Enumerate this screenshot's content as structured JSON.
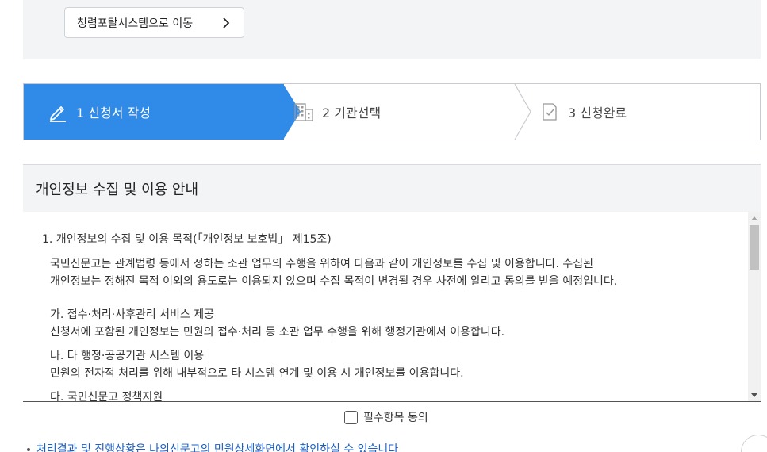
{
  "top": {
    "portal_button_label": "청렴포탈시스템으로 이동"
  },
  "steps": [
    {
      "label": "1 신청서 작성",
      "active": true,
      "icon": "pencil-icon"
    },
    {
      "label": "2 기관선택",
      "active": false,
      "icon": "building-icon"
    },
    {
      "label": "3 신청완료",
      "active": false,
      "icon": "document-check-icon"
    }
  ],
  "section": {
    "title": "개인정보 수집 및 이용 안내"
  },
  "terms": {
    "heading": "1. 개인정보의 수집 및 이용 목적(「개인정보 보호법」 제15조)",
    "intro_line1": "국민신문고는 관계법령 등에서 정하는 소관 업무의 수행을 위하여 다음과 같이 개인정보를 수집 및 이용합니다. 수집된",
    "intro_line2": "개인정보는 정해진 목적 이외의 용도로는 이용되지 않으며 수집 목적이 변경될 경우 사전에 알리고 동의를 받을 예정입니다.",
    "items": [
      {
        "title": "가. 접수·처리·사후관리 서비스 제공",
        "desc": "신청서에 포함된 개인정보는 민원의 접수·처리 등 소관 업무 수행을 위해 행정기관에서 이용합니다."
      },
      {
        "title": "나. 타 행정·공공기관 시스템 이용",
        "desc": "민원의 전자적 처리를 위해 내부적으로 타 시스템 연계 및 이용 시 개인정보를 이용합니다."
      },
      {
        "title": "다. 국민신문고 정책지원",
        "desc": ""
      }
    ]
  },
  "agree": {
    "label": "필수항목 동의",
    "checked": false
  },
  "notice": {
    "text": "처리결과 및 진행상황은 나의신문고의 민원상세화면에서 확인하실 수 있습니다"
  },
  "colors": {
    "active_step": "#2f8ae8",
    "link": "#1a5fc7"
  }
}
